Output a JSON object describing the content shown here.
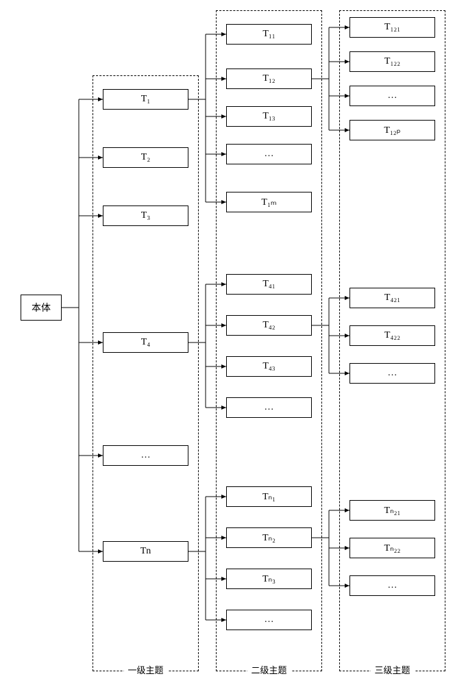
{
  "diagram": {
    "root_label": "本体",
    "column_labels": {
      "level1": "一级主题",
      "level2": "二级主题",
      "level3": "三级主题"
    },
    "level1": {
      "n1": "T₁",
      "n2": "T₂",
      "n3": "T₃",
      "n4": "T₄",
      "n5": "…",
      "n6": "Tn"
    },
    "level2": {
      "g1": {
        "a": "T₁₁",
        "b": "T₁₂",
        "c": "T₁₃",
        "d": "…",
        "e": "T₁ₘ"
      },
      "g4": {
        "a": "T₄₁",
        "b": "T₄₂",
        "c": "T₄₃",
        "d": "…"
      },
      "gn": {
        "a": "Tₙ₁",
        "b": "Tₙ₂",
        "c": "Tₙ₃",
        "d": "…"
      }
    },
    "level3": {
      "g12": {
        "a": "T₁₂₁",
        "b": "T₁₂₂",
        "c": "…",
        "d": "T₁₂ₚ"
      },
      "g42": {
        "a": "T₄₂₁",
        "b": "T₄₂₂",
        "c": "…"
      },
      "gn2": {
        "a": "Tₙ₂₁",
        "b": "Tₙ₂₂",
        "c": "…"
      }
    }
  },
  "chart_data": {
    "type": "tree",
    "title": "",
    "root": {
      "label": "本体",
      "children": [
        {
          "label": "T1",
          "children": [
            {
              "label": "T11"
            },
            {
              "label": "T12",
              "children": [
                {
                  "label": "T121"
                },
                {
                  "label": "T122"
                },
                {
                  "label": "…"
                },
                {
                  "label": "T12p"
                }
              ]
            },
            {
              "label": "T13"
            },
            {
              "label": "…"
            },
            {
              "label": "T1m"
            }
          ]
        },
        {
          "label": "T2"
        },
        {
          "label": "T3"
        },
        {
          "label": "T4",
          "children": [
            {
              "label": "T41"
            },
            {
              "label": "T42",
              "children": [
                {
                  "label": "T421"
                },
                {
                  "label": "T422"
                },
                {
                  "label": "…"
                }
              ]
            },
            {
              "label": "T43"
            },
            {
              "label": "…"
            }
          ]
        },
        {
          "label": "…"
        },
        {
          "label": "Tn",
          "children": [
            {
              "label": "Tn1"
            },
            {
              "label": "Tn2",
              "children": [
                {
                  "label": "Tn21"
                },
                {
                  "label": "Tn22"
                },
                {
                  "label": "…"
                }
              ]
            },
            {
              "label": "Tn3"
            },
            {
              "label": "…"
            }
          ]
        }
      ]
    },
    "column_headers": [
      "一级主题",
      "二级主题",
      "三级主题"
    ]
  }
}
